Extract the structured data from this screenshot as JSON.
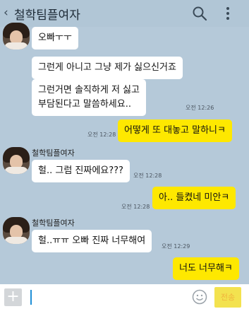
{
  "header": {
    "back_glyph": "‹",
    "title": "철학팀플여자",
    "search_icon": "search-icon",
    "more_icon": "more-vert-icon"
  },
  "messages": [
    {
      "type": "in",
      "text": "오빠ㅜㅜ"
    },
    {
      "type": "in",
      "text": "그런게 아니고 그냥 제가 싫으신거죠"
    },
    {
      "type": "in",
      "lines": [
        "그런거면 솔직하게 저 싫고",
        "부담된다고 말씀하세요.."
      ],
      "time": "오전 12:26"
    },
    {
      "type": "out",
      "text": "어떻게 또 대놓고 말하니ㅋ",
      "time": "오전 12:28"
    },
    {
      "type": "in",
      "sender": "철학팀플여자",
      "text": "헐.. 그럼 진짜에요???",
      "time": "오전 12:28"
    },
    {
      "type": "out",
      "text": "아.. 들켰네 미안ㅋ",
      "time": "오전 12:28"
    },
    {
      "type": "in",
      "sender": "철학팀플여자",
      "text": "헐..ㅠㅠ 오빠 진짜 너무해여",
      "time": "오전 12:29"
    },
    {
      "type": "out",
      "text": "너도 너무해ㅋ"
    }
  ],
  "input": {
    "plus_label": "+",
    "emoji_icon": "emoji-icon",
    "send_label": "전송",
    "text": ""
  },
  "colors": {
    "background": "#b5c9d9",
    "bubble_in": "#ffffff",
    "bubble_out": "#fee800"
  }
}
